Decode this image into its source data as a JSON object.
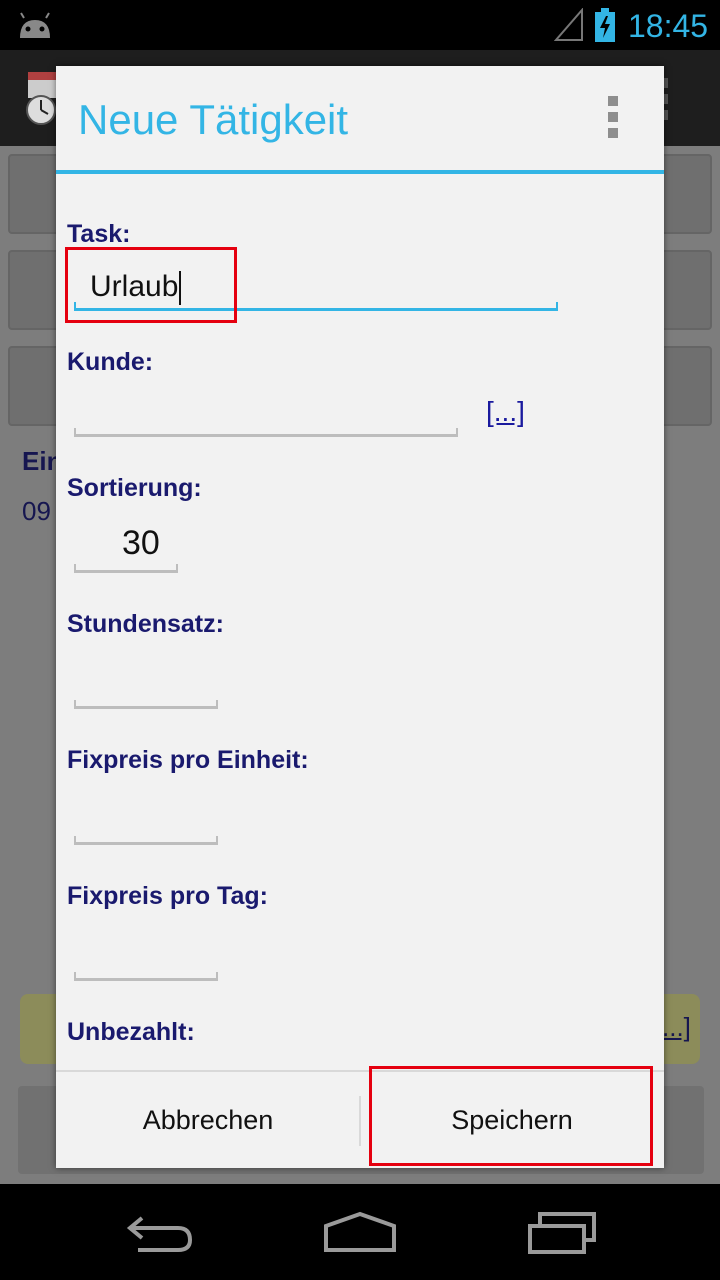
{
  "status_bar": {
    "time": "18:45"
  },
  "background": {
    "partial_label": "Ein",
    "partial_value": "09",
    "partial_link": "...]"
  },
  "dialog": {
    "title": "Neue Tätigkeit",
    "fields": {
      "task": {
        "label": "Task:",
        "value": "Urlaub"
      },
      "kunde": {
        "label": "Kunde:",
        "value": "",
        "picker": "[...]"
      },
      "sortierung": {
        "label": "Sortierung:",
        "value": "30"
      },
      "stundensatz": {
        "label": "Stundensatz:",
        "value": ""
      },
      "fixpreis_einheit": {
        "label": "Fixpreis pro Einheit:",
        "value": ""
      },
      "fixpreis_tag": {
        "label": "Fixpreis pro Tag:",
        "value": ""
      },
      "unbezahlt": {
        "label": "Unbezahlt:"
      }
    },
    "buttons": {
      "cancel": "Abbrechen",
      "save": "Speichern"
    }
  },
  "colors": {
    "accent": "#33b5e5",
    "label": "#1a1a6e",
    "highlight": "#e5000f"
  }
}
